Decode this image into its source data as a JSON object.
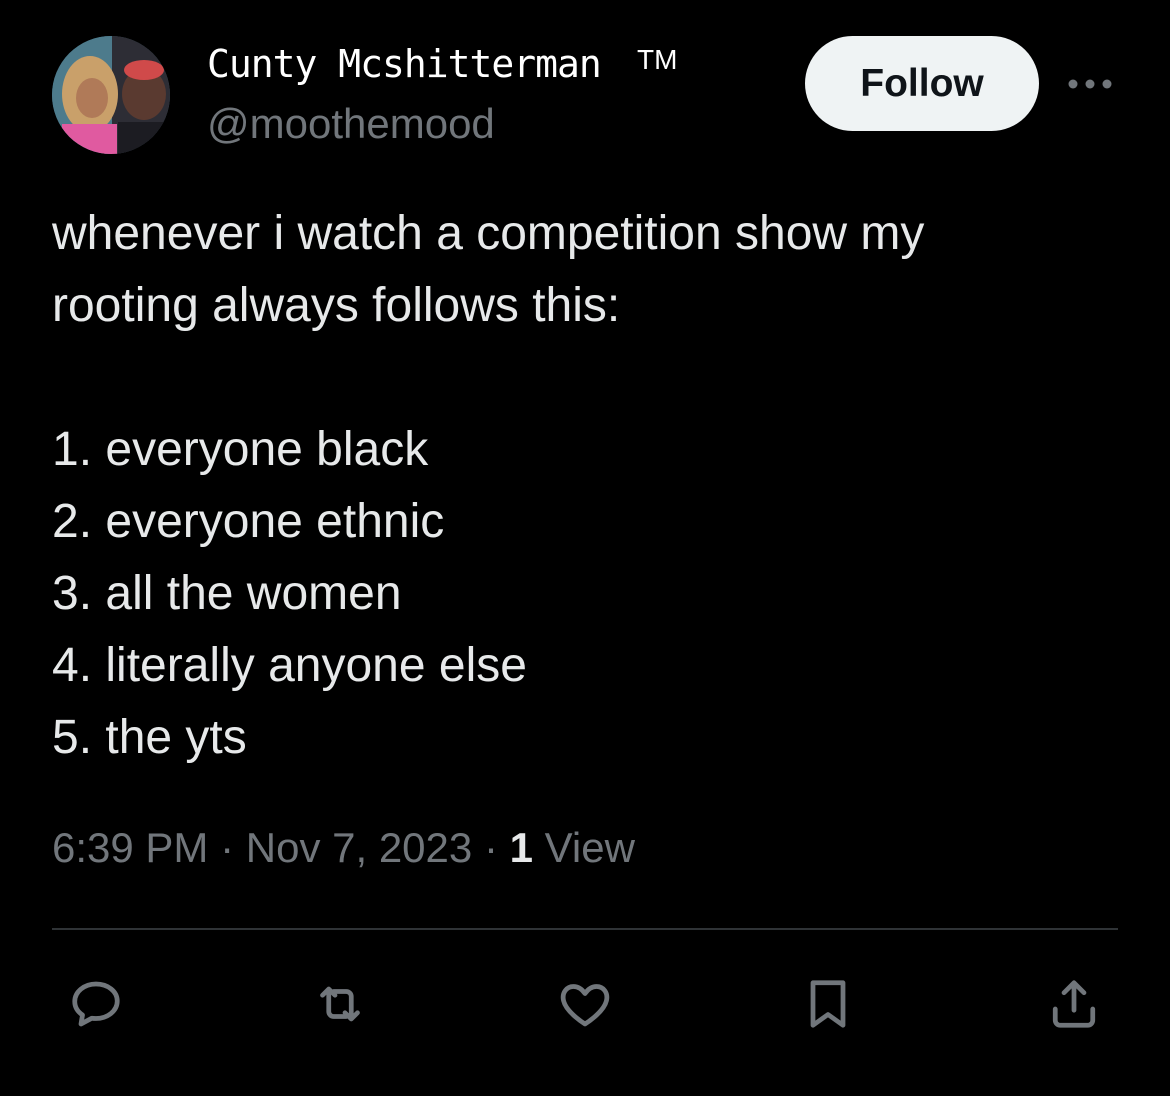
{
  "author": {
    "display_name": "Cunty Mcshitterman",
    "trademark": "TM",
    "handle": "@moothemood"
  },
  "header": {
    "follow_label": "Follow"
  },
  "tweet": {
    "intro_lines": [
      "whenever i watch a competition show my",
      "rooting always follows this:"
    ],
    "list": [
      "1. everyone black",
      "2. everyone ethnic",
      "3. all the women",
      "4. literally anyone else",
      "5. the yts"
    ]
  },
  "meta": {
    "time": "6:39 PM",
    "separator": "·",
    "date": "Nov 7, 2023",
    "view_count": "1",
    "view_label": "View"
  },
  "actions": {
    "icons": [
      "reply-icon",
      "retweet-icon",
      "like-icon",
      "bookmark-icon",
      "share-icon"
    ]
  },
  "colors": {
    "background": "#000000",
    "primary_text": "#e7e9ea",
    "secondary_text": "#71767b",
    "divider": "#2f3336",
    "follow_button_bg": "#eff3f4",
    "follow_button_text": "#0f1419"
  }
}
